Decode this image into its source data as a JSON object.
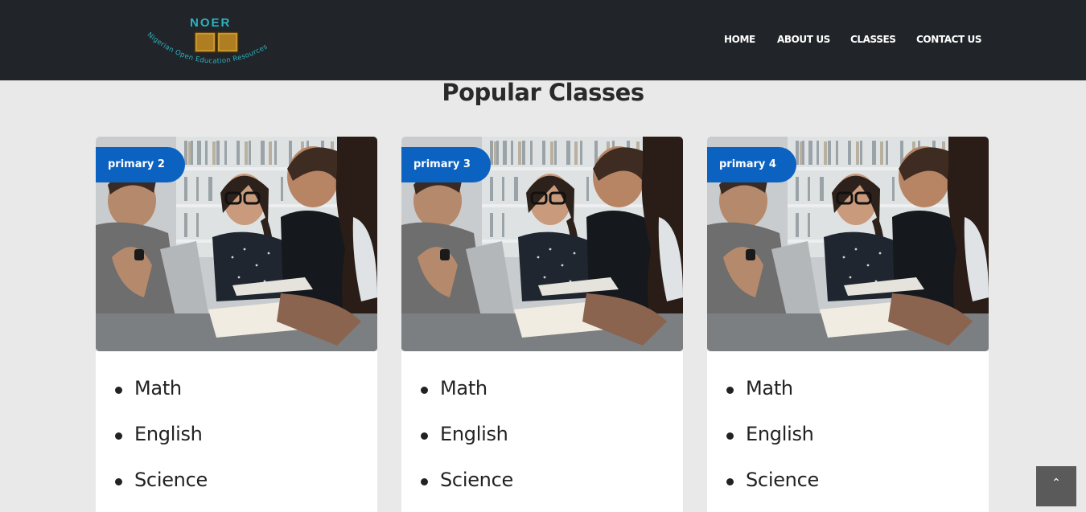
{
  "brand": {
    "title": "NOER",
    "tagline": "Nigerian Open Education Resources"
  },
  "nav": {
    "items": [
      {
        "label": "HOME"
      },
      {
        "label": "ABOUT US"
      },
      {
        "label": "CLASSES"
      },
      {
        "label": "CONTACT US"
      }
    ]
  },
  "section": {
    "heading": "Popular Classes"
  },
  "cards": [
    {
      "badge": "primary 2",
      "subjects": [
        "Math",
        "English",
        "Science"
      ]
    },
    {
      "badge": "primary 3",
      "subjects": [
        "Math",
        "English",
        "Science"
      ]
    },
    {
      "badge": "primary 4",
      "subjects": [
        "Math",
        "English",
        "Science"
      ]
    }
  ],
  "back_to_top": {
    "icon": "chevron-up-icon",
    "glyph": "⌃"
  },
  "colors": {
    "navbar": "#212428",
    "badge": "#0b62c1",
    "page_bg": "#e9e9e9",
    "logo_teal": "#2bb3c0"
  }
}
